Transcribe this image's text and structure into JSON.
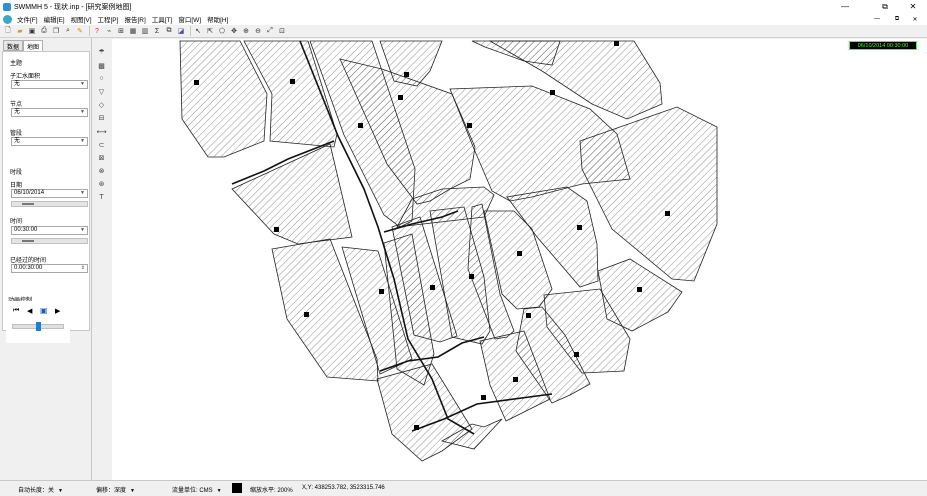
{
  "window": {
    "title": "SWMMH 5 - 现状.inp - [研究案例地图]",
    "minimize": "—",
    "restore": "⧉",
    "close": "✕"
  },
  "menu": [
    "文件[F]",
    "编辑[E]",
    "视图[V]",
    "工程[P]",
    "报告[R]",
    "工具[T]",
    "窗口[W]",
    "帮助[H]"
  ],
  "toolbar_icons": [
    "new-icon",
    "open-icon",
    "save-icon",
    "print-icon",
    "copy-icon",
    "find-icon",
    "query-icon",
    "profile-icon",
    "time-series-icon",
    "scatter-icon",
    "table-icon",
    "statistics-icon",
    "options-icon",
    "arrange-icon",
    "select-icon",
    "vertex-icon",
    "region-icon",
    "pan-icon",
    "zoom-in-icon",
    "zoom-out-icon",
    "full-extent-icon",
    "measure-icon"
  ],
  "panel": {
    "tabs": [
      "数据",
      "地图"
    ],
    "active_tab": "地图",
    "theme_header": "主题",
    "subcatch_label": "子汇水面积",
    "subcatch_value": "无",
    "node_label": "节点",
    "node_value": "无",
    "link_label": "管段",
    "link_value": "无",
    "time_header": "时段",
    "date_label": "日期",
    "date_value": "06/10/2014",
    "time_label": "时间",
    "time_value": "00:30:00",
    "elapsed_label": "已经过的时间",
    "elapsed_value": "0.00:30:00",
    "anim_label": "动画控制"
  },
  "map": {
    "date_time": "06/10/2014 00:30:00"
  },
  "status": {
    "autolength": "自动长度：关",
    "offsets": "偏移：深度",
    "flow_units": "流量单位: CMS",
    "zoom": "缩放水平: 200%",
    "xy": "X,Y: 438253.782, 3523315.746"
  }
}
